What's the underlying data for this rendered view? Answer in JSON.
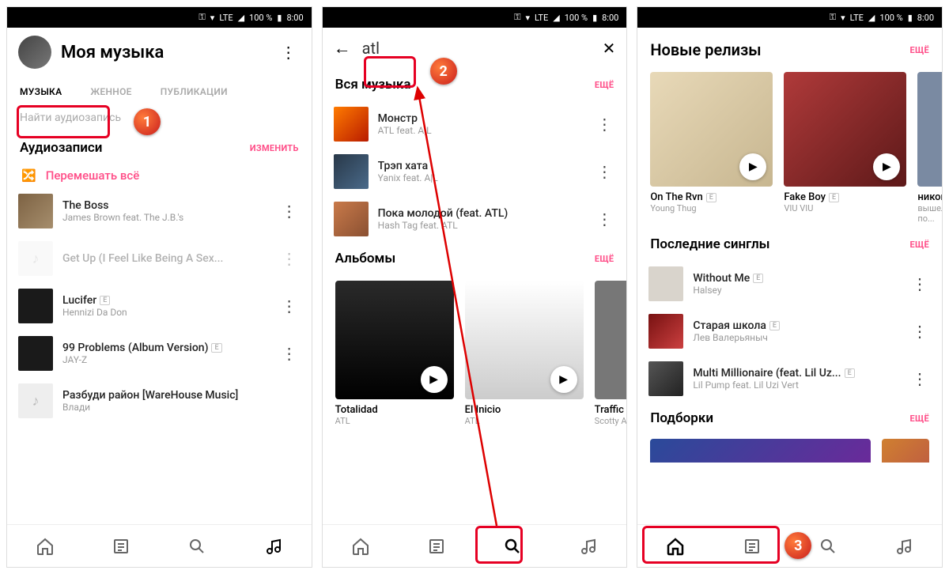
{
  "status_bar": {
    "signal_label": "LTE",
    "battery_text": "100 %",
    "time": "8:00"
  },
  "screen1": {
    "title": "Моя музыка",
    "tabs": {
      "music": "МУЗЫКА",
      "downloaded": "ЖЕННОЕ",
      "posts": "ПУБЛИКАЦИИ"
    },
    "search_placeholder": "Найти аудиозапись",
    "section_audio": "Аудиозаписи",
    "edit": "ИЗМЕНИТЬ",
    "shuffle": "Перемешать всё",
    "tracks": [
      {
        "title": "The Boss",
        "artist": "James Brown feat. The J.B.'s"
      },
      {
        "title": "Get Up (I Feel Like Being A Sex...",
        "artist": ""
      },
      {
        "title": "Lucifer",
        "artist": "Hennizi Da Don",
        "explicit": true
      },
      {
        "title": "99 Problems (Album Version)",
        "artist": "JAY-Z",
        "explicit": true
      },
      {
        "title": "Разбуди район [WareHouse Music]",
        "artist": "Влади"
      }
    ]
  },
  "screen2": {
    "search_query": "atl",
    "section_all_music": "Вся музыка",
    "more": "ЕЩЁ",
    "tracks": [
      {
        "title": "Монстр",
        "artist": "ATL feat. A|L"
      },
      {
        "title": "Трэп хата",
        "artist": "Yanix feat. A|L"
      },
      {
        "title": "Пока молодой (feat. ATL)",
        "artist": "Hash Tag feat. ATL"
      }
    ],
    "section_albums": "Альбомы",
    "albums": [
      {
        "title": "Totalidad",
        "artist": "ATL"
      },
      {
        "title": "El Inicio",
        "artist": "ATL"
      },
      {
        "title": "Traffic Ja...",
        "artist": "Scotty ATL"
      }
    ]
  },
  "screen3": {
    "section_new": "Новые релизы",
    "more": "ЕЩЁ",
    "releases": [
      {
        "title": "On The Rvn",
        "artist": "Young Thug",
        "explicit": true
      },
      {
        "title": "Fake Boy",
        "artist": "VIU VIU",
        "explicit": true
      },
      {
        "title": "никогда...",
        "artist": "вышел по..."
      }
    ],
    "section_singles": "Последние синглы",
    "singles": [
      {
        "title": "Without Me",
        "artist": "Halsey",
        "explicit": true
      },
      {
        "title": "Старая школа",
        "artist": "Лев Валерьяныч",
        "explicit": true
      },
      {
        "title": "Multi Millionaire (feat. Lil Uz...",
        "artist": "Lil Pump feat. Lil Uzi Vert",
        "explicit": true
      }
    ],
    "section_collections": "Подборки"
  },
  "badges": {
    "b1": "1",
    "b2": "2",
    "b3": "3"
  }
}
